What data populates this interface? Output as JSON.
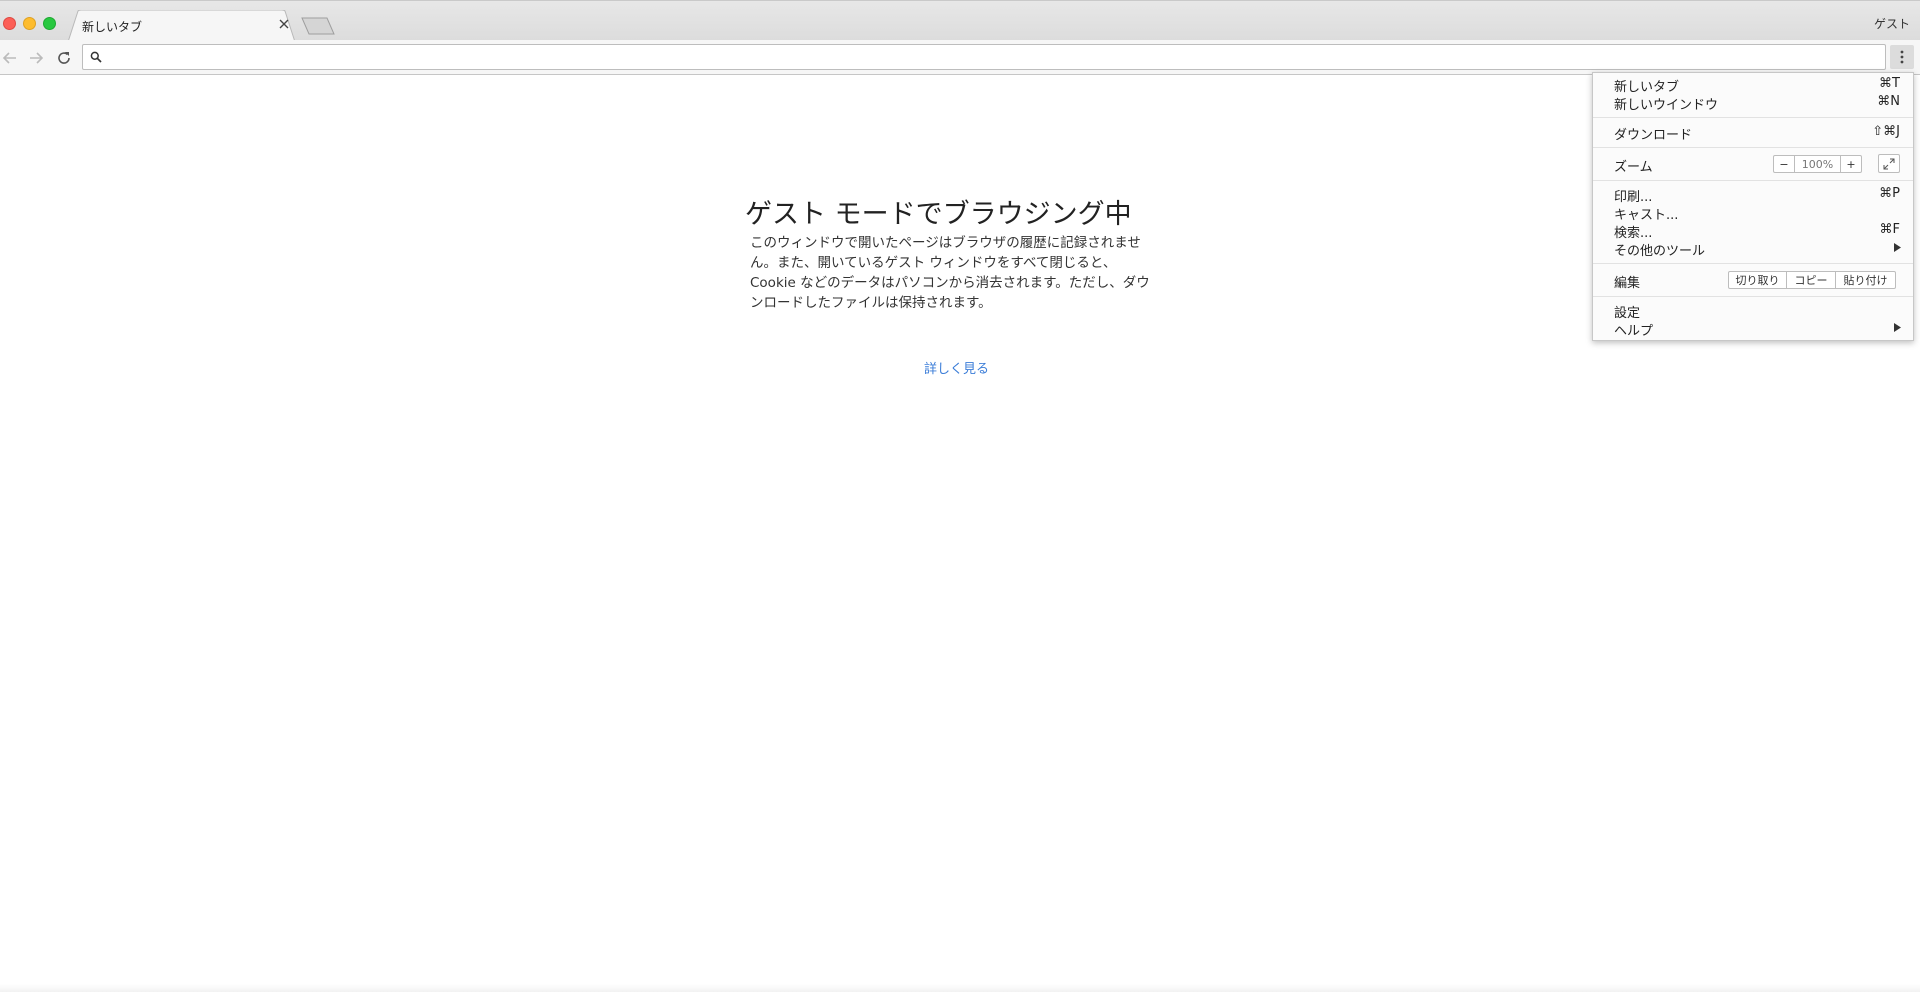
{
  "tabstrip": {
    "tab_title": "新しいタブ",
    "profile_label": "ゲスト"
  },
  "toolbar": {
    "omnibox_value": "",
    "omnibox_placeholder": ""
  },
  "page": {
    "title": "ゲスト モードでブラウジング中",
    "body_lines": [
      "このウィンドウで開いたページはブラウザの履歴に記録されませ",
      "ん。また、開いているゲスト ウィンドウをすべて閉じると、",
      "Cookie などのデータはパソコンから消去されます。ただし、ダウ",
      "ンロードしたファイルは保持されます。"
    ],
    "learn_more": "詳しく見る"
  },
  "menu": {
    "new_tab": {
      "label": "新しいタブ",
      "shortcut": "⌘T"
    },
    "new_window": {
      "label": "新しいウインドウ",
      "shortcut": "⌘N"
    },
    "downloads": {
      "label": "ダウンロード",
      "shortcut": "⇧⌘J"
    },
    "zoom": {
      "label": "ズーム",
      "level": "100%",
      "minus": "−",
      "plus": "+"
    },
    "print": {
      "label": "印刷...",
      "shortcut": "⌘P"
    },
    "cast": {
      "label": "キャスト..."
    },
    "find": {
      "label": "検索...",
      "shortcut": "⌘F"
    },
    "more_tools": {
      "label": "その他のツール"
    },
    "edit": {
      "label": "編集",
      "cut": "切り取り",
      "copy": "コピー",
      "paste": "貼り付け"
    },
    "settings": {
      "label": "設定"
    },
    "help": {
      "label": "ヘルプ"
    }
  },
  "colors": {
    "link": "#3b7dd8",
    "traffic_close": "#fc5f57",
    "traffic_minimize": "#fdbc2e",
    "traffic_maximize": "#28c840"
  }
}
